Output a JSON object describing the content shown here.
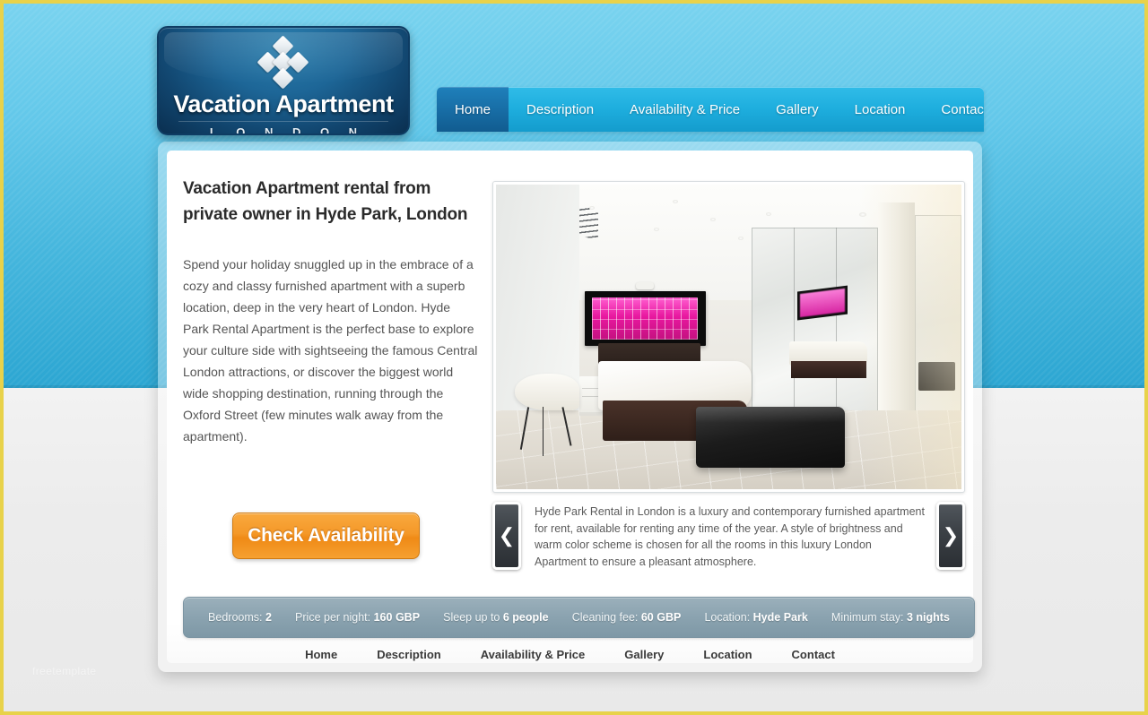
{
  "site": {
    "logo_title": "Vacation Apartment",
    "logo_subtitle": "L O N D O N",
    "logo_icon": "diamond-cross-icon"
  },
  "nav": {
    "items": [
      {
        "label": "Home",
        "active": true
      },
      {
        "label": "Description",
        "active": false
      },
      {
        "label": "Availability & Price",
        "active": false
      },
      {
        "label": "Gallery",
        "active": false
      },
      {
        "label": "Location",
        "active": false
      },
      {
        "label": "Contact",
        "active": false
      }
    ]
  },
  "main": {
    "headline": "Vacation Apartment rental from private owner in Hyde Park, London",
    "body": "Spend your holiday snuggled up in the embrace of a cozy and classy furnished apartment with a superb location, deep in the very heart of London. Hyde Park Rental Apartment is the perfect base to explore your culture side with sightseeing the famous Central London attractions, or discover the biggest world wide shopping destination, running through the Oxford Street (few minutes walk away from the apartment).",
    "cta_label": "Check Availability",
    "hero_image_alt": "Modern white bedroom with pink artwork, dark bed base, black leather ottoman and mirrored wardrobe"
  },
  "slider": {
    "prev_label": "❮",
    "next_label": "❯",
    "caption": "Hyde Park Rental in London is a luxury and contemporary furnished apartment for rent, available for renting any time of the year. A style of brightness and warm color scheme is chosen for all the rooms in this luxury London Apartment to ensure a pleasant atmosphere."
  },
  "info_bar": {
    "items": [
      {
        "label": "Bedrooms:",
        "value": "2"
      },
      {
        "label": "Price per night:",
        "value": "160 GBP"
      },
      {
        "label": "Sleep up to",
        "value": "6 people"
      },
      {
        "label": "Cleaning fee:",
        "value": "60 GBP"
      },
      {
        "label": "Location:",
        "value": "Hyde Park"
      },
      {
        "label": "Minimum stay:",
        "value": "3 nights"
      }
    ]
  },
  "footer": {
    "links": [
      "Home",
      "Description",
      "Availability & Price",
      "Gallery",
      "Location",
      "Contact"
    ],
    "watermark": "freetemplate"
  },
  "colors": {
    "sky_top": "#79d3ef",
    "sky_bottom": "#2ca6d2",
    "frame": "#e8d24a",
    "nav": "#1eaede",
    "nav_active": "#176ca4",
    "cta": "#f49828",
    "info_bar": "#8ba3b0",
    "page_gray": "#ebebeb"
  }
}
